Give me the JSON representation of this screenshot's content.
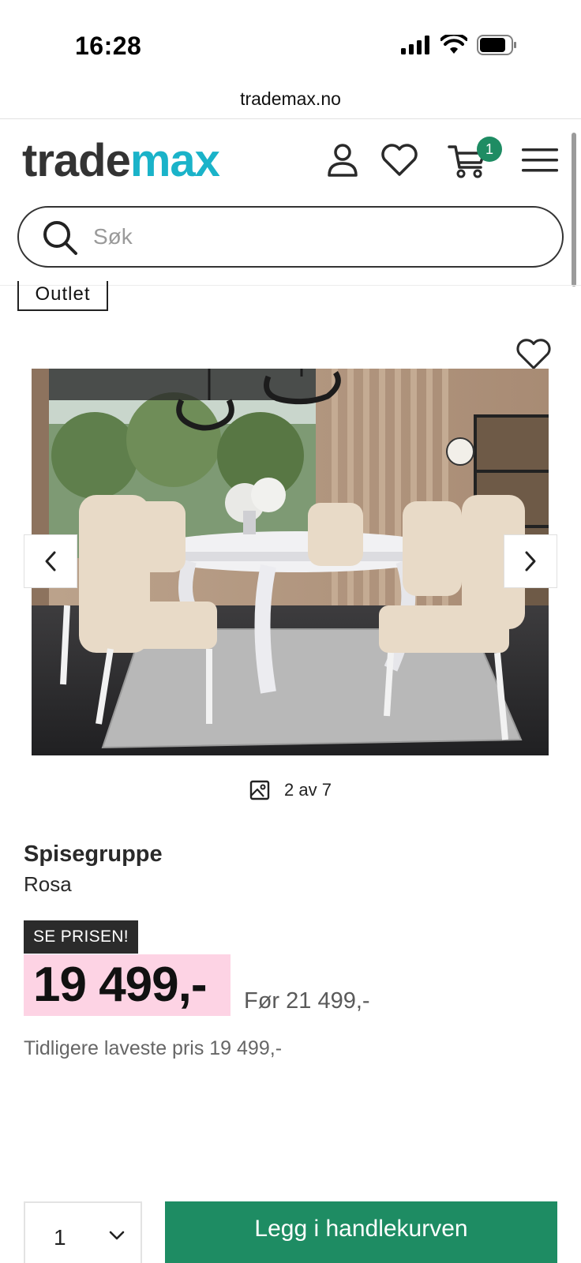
{
  "status_bar": {
    "time": "16:28"
  },
  "browser": {
    "url": "trademax.no"
  },
  "header": {
    "logo_part1": "trade",
    "logo_part2": "max",
    "cart_count": "1",
    "search_placeholder": "Søk",
    "icons": [
      "user-icon",
      "heart-icon",
      "cart-icon",
      "menu-icon"
    ]
  },
  "product": {
    "tag": "Outlet",
    "gallery_counter": "2 av 7",
    "name": "Spisegruppe",
    "variant": "Rosa",
    "price_badge": "SE PRISEN!",
    "price": "19 499,-",
    "price_before": "Før 21 499,-",
    "price_lowest": "Tidligere laveste pris 19 499,-"
  },
  "purchase": {
    "quantity": "1",
    "add_to_cart_label": "Legg i handlekurven"
  },
  "colors": {
    "brand_teal": "#1ab3c9",
    "brand_green": "#1e8c63",
    "price_highlight": "#fdd3e4",
    "badge_dark": "#2b2b2b"
  }
}
